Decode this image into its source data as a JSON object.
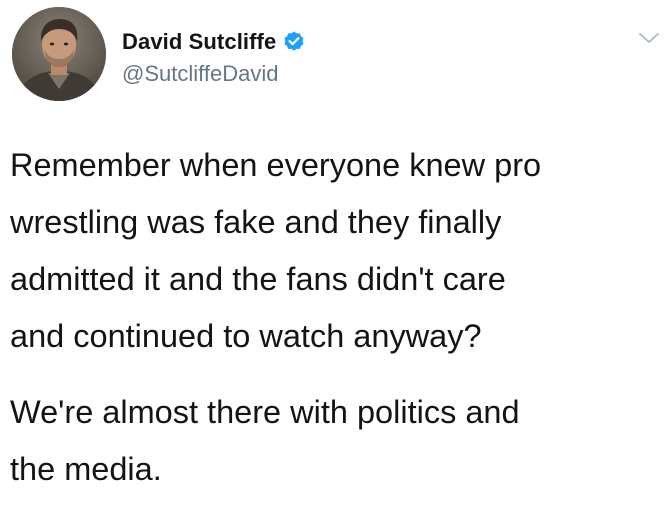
{
  "tweet": {
    "author": {
      "display_name": "David Sutcliffe",
      "handle": "@SutcliffeDavid",
      "verified": true,
      "avatar_icon": "profile-photo"
    },
    "menu_icon": "chevron-down-icon",
    "paragraphs": [
      "Remember when everyone knew pro\nwrestling was fake and they finally\nadmitted it and the fans didn't care\nand continued to watch anyway?",
      "We're almost there with politics and\nthe media."
    ]
  },
  "colors": {
    "verified_badge": "#1DA1F2",
    "handle_text": "#657786",
    "body_text": "#141414",
    "background": "#FFFFFF"
  }
}
